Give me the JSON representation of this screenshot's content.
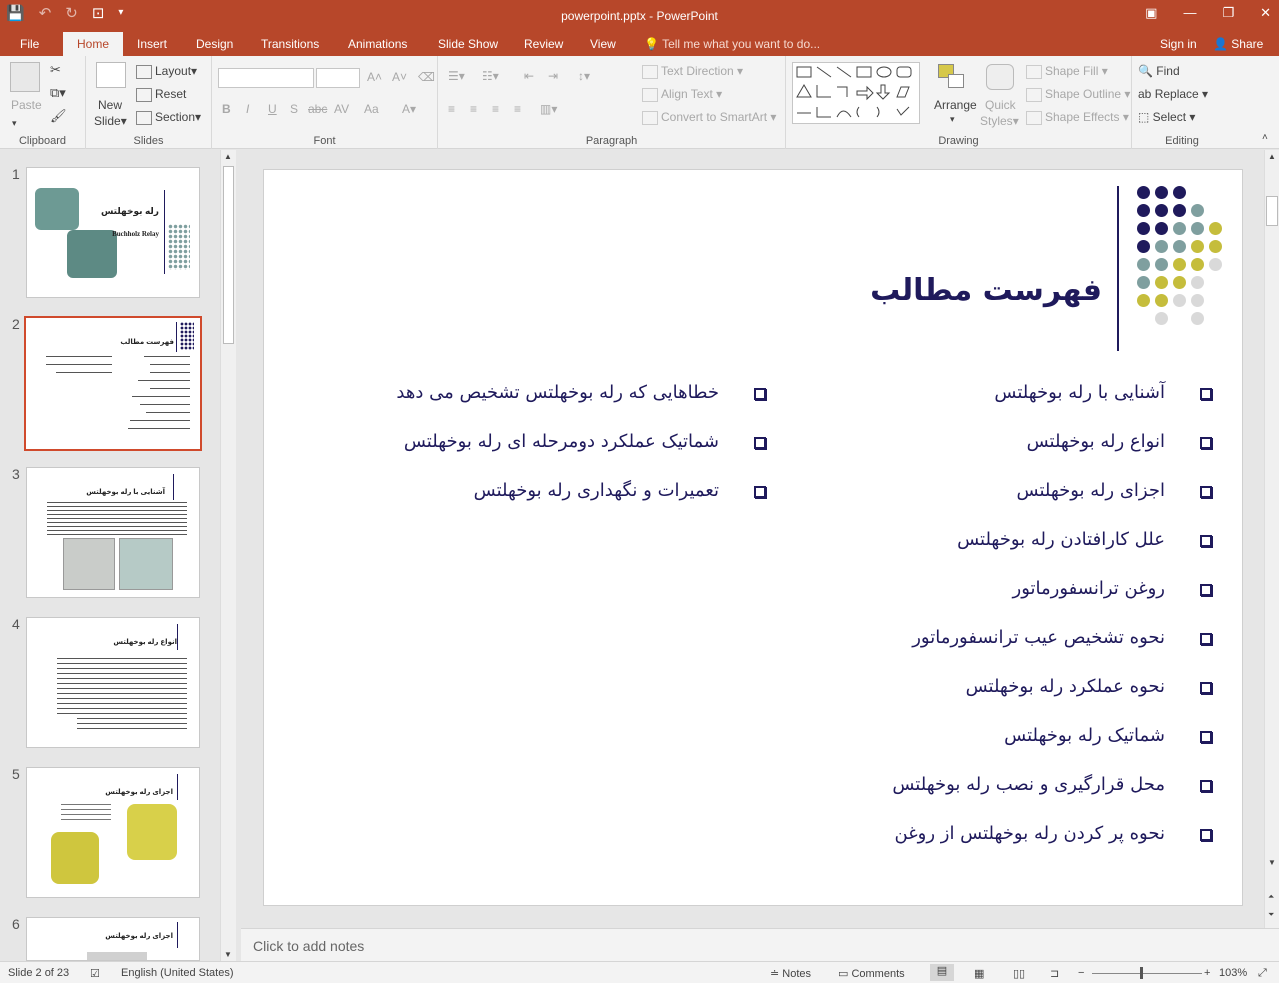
{
  "window": {
    "title": "powerpoint.pptx - PowerPoint",
    "tabs": [
      "File",
      "Home",
      "Insert",
      "Design",
      "Transitions",
      "Animations",
      "Slide Show",
      "Review",
      "View"
    ],
    "tell_me": "Tell me what you want to do...",
    "sign_in": "Sign in",
    "share": "Share"
  },
  "ribbon": {
    "clipboard": {
      "paste": "Paste",
      "label": "Clipboard"
    },
    "slides": {
      "new_slide_1": "New",
      "new_slide_2": "Slide",
      "layout": "Layout",
      "reset": "Reset",
      "section": "Section",
      "label": "Slides"
    },
    "font": {
      "label": "Font",
      "bold": "B",
      "italic": "I",
      "underline": "U",
      "shadow": "S",
      "strike": "abc",
      "spacing": "AV",
      "case": "Aa"
    },
    "paragraph": {
      "text_direction": "Text Direction",
      "align_text": "Align Text",
      "convert_smartart": "Convert to SmartArt",
      "label": "Paragraph"
    },
    "drawing": {
      "arrange": "Arrange",
      "quick_1": "Quick",
      "quick_2": "Styles",
      "shape_fill": "Shape Fill",
      "shape_outline": "Shape Outline",
      "shape_effects": "Shape Effects",
      "label": "Drawing"
    },
    "editing": {
      "find": "Find",
      "replace": "Replace",
      "select": "Select",
      "label": "Editing"
    }
  },
  "thumbnails": [
    {
      "num": "1",
      "title": "رله بوخهلتس",
      "subtitle": "Buchholz Relay"
    },
    {
      "num": "2",
      "title": "فهرست مطالب"
    },
    {
      "num": "3",
      "title": "آشنایی با رله بوخهلتس"
    },
    {
      "num": "4",
      "title": "انواع رله بوخهلتس"
    },
    {
      "num": "5",
      "title": "اجزای رله بوخهلتس"
    },
    {
      "num": "6",
      "title": "اجزای رله بوخهلتس"
    }
  ],
  "slide": {
    "title": "فهرست مطالب",
    "right_items": [
      "آشنایی با رله بوخهلتس",
      "انواع رله بوخهلتس",
      "اجزای رله بوخهلتس",
      "علل کارافتادن رله بوخهلتس",
      "روغن ترانسفورماتور",
      "نحوه تشخیص عیب ترانسفورماتور",
      "نحوه عملکرد رله بوخهلتس",
      "شماتیک رله بوخهلتس",
      "محل قرارگیری و نصب رله بوخهلتس",
      "نحوه پر کردن رله بوخهلتس از روغن"
    ],
    "left_items": [
      "خطاهایی که رله بوخهلتس تشخیص می دهد",
      "شماتیک عملکرد دومرحله ای رله بوخهلتس",
      "تعمیرات و نگهداری رله بوخهلتس"
    ],
    "colors": {
      "navy": "#1f1a5c",
      "teal": "#7f9f9f",
      "olive": "#c5bd3c",
      "gray": "#d9d9d9"
    }
  },
  "notes_placeholder": "Click to add notes",
  "status": {
    "slide_info": "Slide 2 of 23",
    "language": "English (United States)",
    "notes": "Notes",
    "comments": "Comments",
    "zoom": "103%"
  }
}
